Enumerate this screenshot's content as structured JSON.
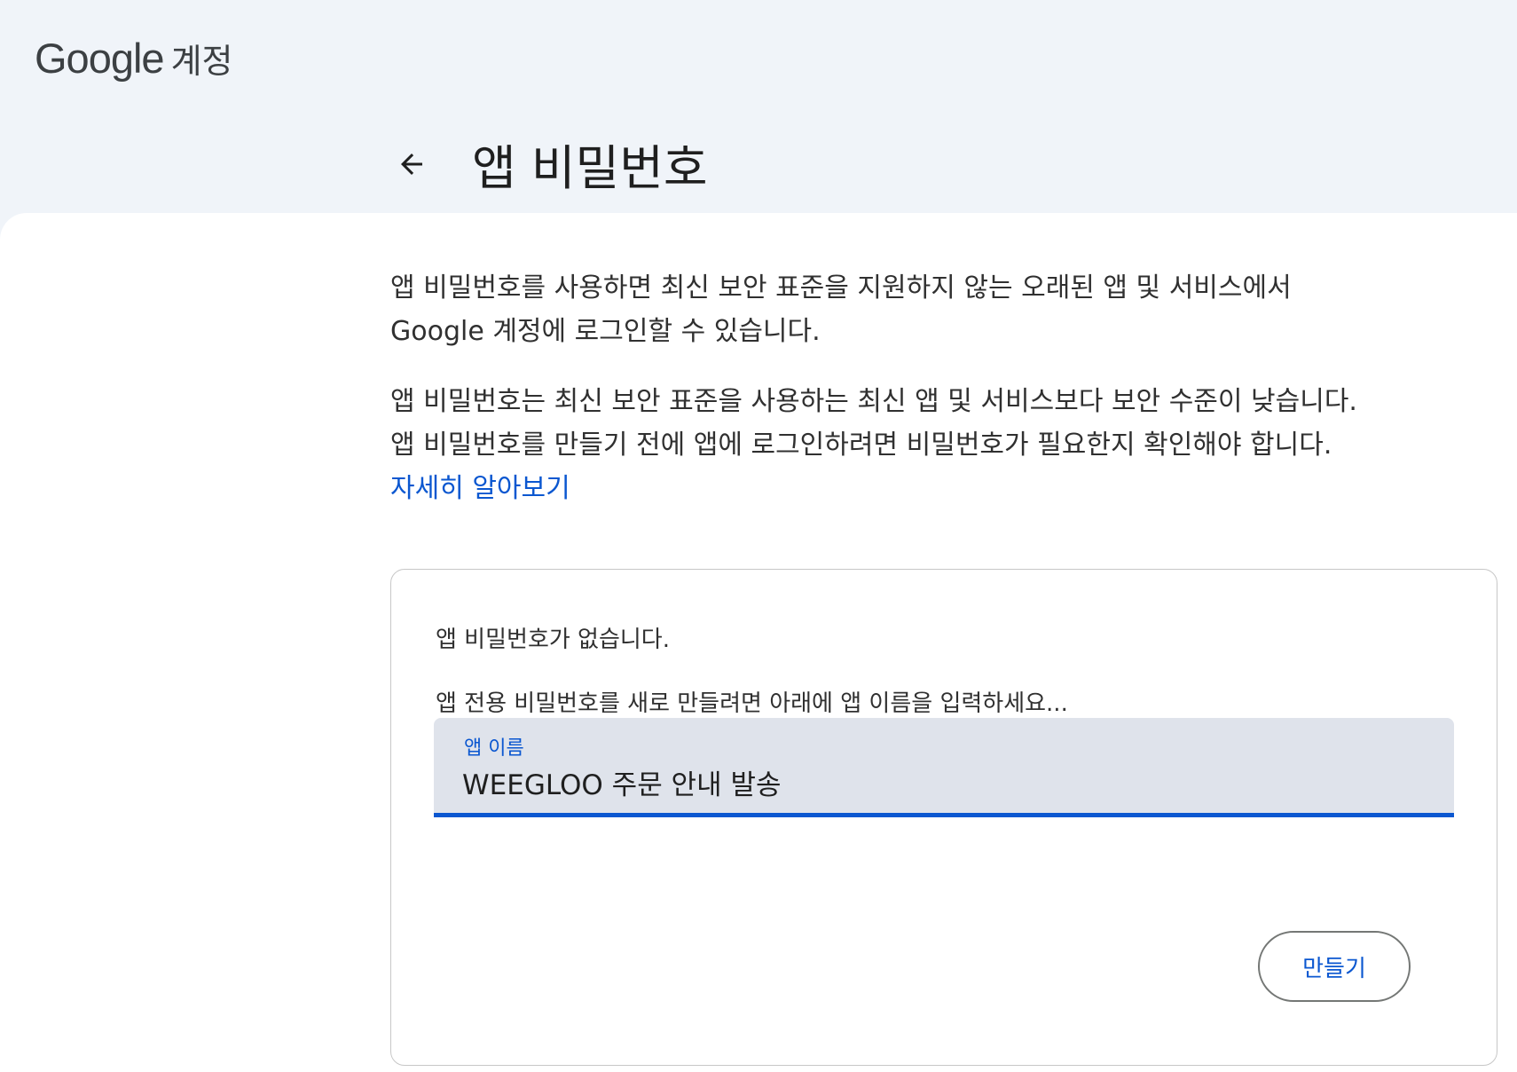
{
  "header": {
    "logo_brand": "Google",
    "logo_product": "계정"
  },
  "page": {
    "title": "앱 비밀번호",
    "back_icon": "arrow-left-icon"
  },
  "description": {
    "paragraph1_line1": "앱 비밀번호를 사용하면 최신 보안 표준을 지원하지 않는 오래된 앱 및 서비스에서",
    "paragraph1_line2": "Google 계정에 로그인할 수 있습니다.",
    "paragraph2_line1": "앱 비밀번호는 최신 보안 표준을 사용하는 최신 앱 및 서비스보다 보안 수준이 낮습니다.",
    "paragraph2_line2": "앱 비밀번호를 만들기 전에 앱에 로그인하려면 비밀번호가 필요한지 확인해야 합니다.",
    "learn_more": "자세히 알아보기"
  },
  "card": {
    "empty_message": "앱 비밀번호가 없습니다.",
    "instruction": "앱 전용 비밀번호를 새로 만들려면 아래에 앱 이름을 입력하세요...",
    "field_label": "앱 이름",
    "field_value": "WEEGLOO 주문 안내 발송",
    "create_button": "만들기"
  },
  "colors": {
    "accent": "#0b57d0",
    "page_background": "#f0f4f9",
    "field_background": "#dfe3eb"
  }
}
